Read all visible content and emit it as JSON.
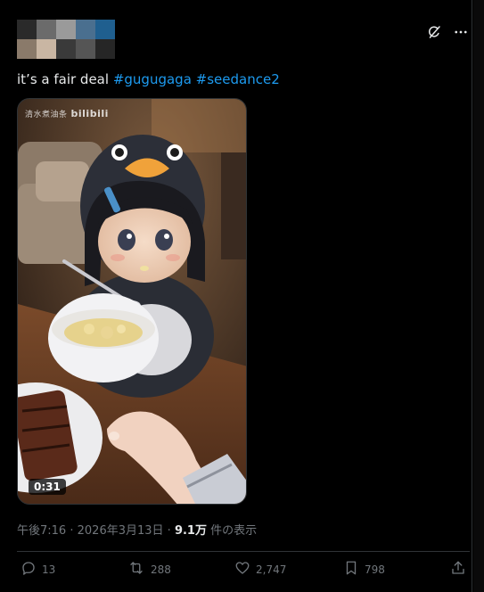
{
  "post": {
    "text": "it’s a fair deal",
    "hashtags": [
      "#gugugaga",
      "#seedance2"
    ],
    "media": {
      "watermark": "清水煮油条",
      "watermark_brand": "bilibili",
      "duration": "0:31"
    },
    "meta": {
      "time": "午後7:16",
      "separator": "·",
      "date": "2026年3月13日",
      "views_count": "9.1万",
      "views_label": "件の表示"
    },
    "actions": {
      "replies": "13",
      "reposts": "288",
      "likes": "2,747",
      "bookmarks": "798"
    }
  },
  "icons": {
    "translate": "grok-translate-icon",
    "more": "more-options-icon",
    "reply": "reply-icon",
    "repost": "repost-icon",
    "like": "heart-icon",
    "bookmark": "bookmark-icon",
    "share": "share-icon"
  },
  "colors": {
    "background": "#000000",
    "text": "#e7e9ea",
    "secondary": "#71767b",
    "link": "#1d9bf0",
    "border": "#2f3336"
  }
}
